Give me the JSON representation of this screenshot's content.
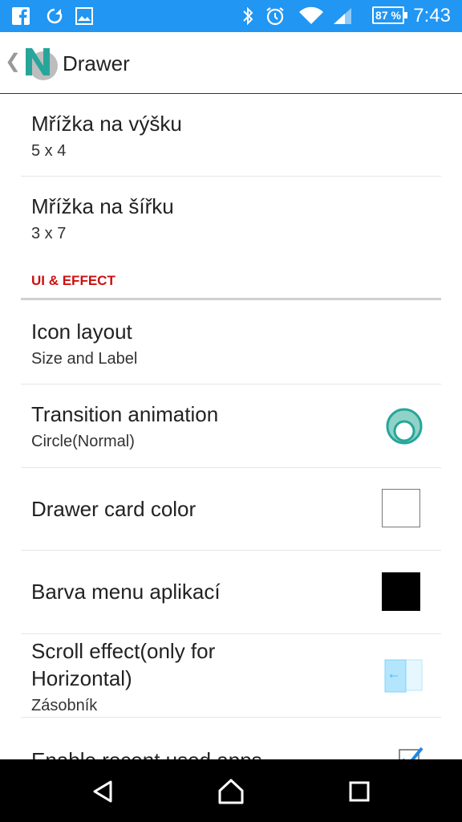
{
  "status": {
    "battery": "87 %",
    "time": "7:43"
  },
  "appbar": {
    "title": "Drawer"
  },
  "items": [
    {
      "title": "Mřížka na výšku",
      "sub": "5 x 4"
    },
    {
      "title": "Mřížka na šířku",
      "sub": "3 x 7"
    }
  ],
  "section": {
    "label": "UI & EFFECT"
  },
  "ui_items": [
    {
      "title": "Icon layout",
      "sub": "Size and Label"
    },
    {
      "title": "Transition animation",
      "sub": "Circle(Normal)"
    },
    {
      "title": "Drawer card color",
      "swatch": "#ffffff"
    },
    {
      "title": "Barva menu aplikací",
      "swatch": "#000000"
    },
    {
      "title": "Scroll effect(only for Horizontal)",
      "sub": "Zásobník"
    },
    {
      "title": "Enable recent used apps",
      "checked": true
    }
  ],
  "colors": {
    "status_bar": "#2196f3",
    "accent": "#cc1010",
    "teal": "#26a69a"
  }
}
